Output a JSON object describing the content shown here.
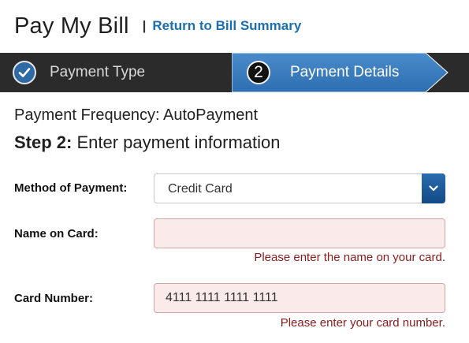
{
  "header": {
    "title": "Pay My Bill",
    "separator": "|",
    "return_link": "Return to Bill Summary"
  },
  "steps": [
    {
      "label": "Payment Type",
      "status": "completed",
      "icon": "check-icon"
    },
    {
      "number": "2",
      "label": "Payment Details",
      "status": "current"
    }
  ],
  "form": {
    "frequency": "Payment Frequency: AutoPayment",
    "step_prefix": "Step 2:",
    "step_text": " Enter payment information",
    "method": {
      "label": "Method of Payment:",
      "value": "Credit Card",
      "icon": "chevron-down-icon"
    },
    "name_on_card": {
      "label": "Name on Card:",
      "value": "",
      "error": "Please enter the name on your card."
    },
    "card_number": {
      "label": "Card Number:",
      "value": "4111 1111 1111 1111",
      "error": "Please enter your card number."
    }
  },
  "colors": {
    "link": "#1a6fae",
    "stepbar_bg": "#2b2b2b",
    "active_step": "#3a7cc0",
    "error_text": "#8b1a1a",
    "error_field_bg": "#fbeaea",
    "select_button": "#1d5a9a"
  }
}
